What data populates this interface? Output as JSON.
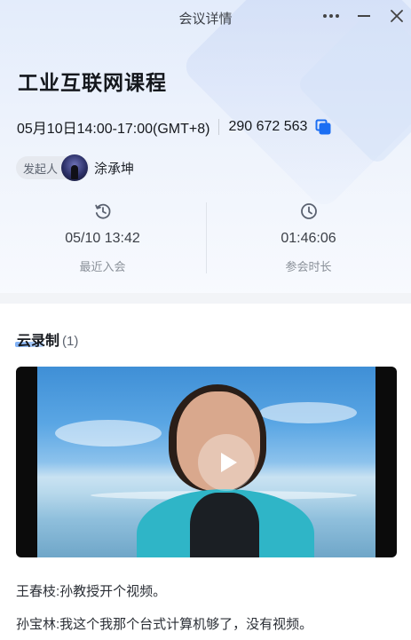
{
  "window": {
    "title": "会议详情",
    "controls": [
      "more-icon",
      "minimize-icon",
      "close-icon"
    ]
  },
  "meeting": {
    "title": "工业互联网课程",
    "time": "05月10日14:00-17:00(GMT+8)",
    "meeting_id": "290 672 563",
    "host_label": "发起人",
    "host_name": "涂承坤"
  },
  "stats": {
    "last_join_value": "05/10 13:42",
    "last_join_label": "最近入会",
    "duration_value": "01:46:06",
    "duration_label": "参会时长"
  },
  "recordings": {
    "title": "云录制",
    "count": "(1)"
  },
  "transcript": [
    {
      "speaker": "王春枝:",
      "text": "孙教授开个视频。"
    },
    {
      "speaker": "孙宝林:",
      "text": "我这个我那个台式计算机够了，没有视频。"
    }
  ],
  "colors": {
    "accent": "#1b6ef3",
    "header_bg": "#e3ecfb",
    "muted_text": "#8a9099"
  }
}
